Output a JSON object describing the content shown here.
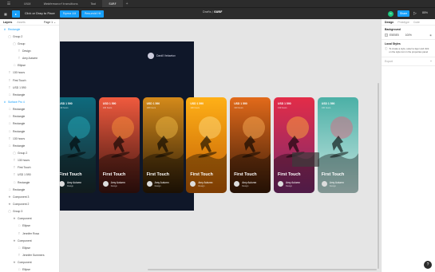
{
  "titlebar": {
    "tabs": [
      "UIUX",
      "Webfemoncrf transitions",
      "Tool",
      "SURF"
    ],
    "active_tab": 3
  },
  "toolbar": {
    "move_tool": "▸",
    "tooltip": "Click or Drag to Place",
    "button_a": "Figma Alt",
    "button_b": "Resumid Ht",
    "center_prefix": "Drafts /",
    "center_file": "SURF",
    "avatar_initial": "G",
    "share_label": "Share",
    "zoom_label": "85%"
  },
  "layers_panel": {
    "tab_layers": "Layers",
    "tab_assets": "Assets",
    "page_label": "Page 1 ⌄",
    "items": [
      {
        "label": "Rectangle",
        "indent": 0,
        "kind": "frame"
      },
      {
        "label": "Group 2",
        "indent": 1,
        "kind": "group"
      },
      {
        "label": "Group",
        "indent": 2,
        "kind": "group"
      },
      {
        "label": "Design",
        "indent": 3,
        "kind": "text"
      },
      {
        "label": "Amy Autumn",
        "indent": 3,
        "kind": "text"
      },
      {
        "label": "Ellipse",
        "indent": 2,
        "kind": "shape"
      },
      {
        "label": "130 hours",
        "indent": 1,
        "kind": "text"
      },
      {
        "label": "First Touch",
        "indent": 1,
        "kind": "text"
      },
      {
        "label": "USD 1 590",
        "indent": 1,
        "kind": "text"
      },
      {
        "label": "Rectangle",
        "indent": 1,
        "kind": "shape"
      },
      {
        "label": "Surface Pro 4",
        "indent": 0,
        "kind": "frame"
      },
      {
        "label": "Rectangle",
        "indent": 1,
        "kind": "shape"
      },
      {
        "label": "Rectangle",
        "indent": 1,
        "kind": "shape"
      },
      {
        "label": "Rectangle",
        "indent": 1,
        "kind": "shape"
      },
      {
        "label": "Rectangle",
        "indent": 1,
        "kind": "shape"
      },
      {
        "label": "130 hours",
        "indent": 1,
        "kind": "text"
      },
      {
        "label": "Rectangle",
        "indent": 1,
        "kind": "shape"
      },
      {
        "label": "Group 2",
        "indent": 2,
        "kind": "group"
      },
      {
        "label": "130 hours",
        "indent": 2,
        "kind": "text"
      },
      {
        "label": "First Touch",
        "indent": 2,
        "kind": "text"
      },
      {
        "label": "USD 1 590",
        "indent": 2,
        "kind": "text"
      },
      {
        "label": "Rectangle",
        "indent": 2,
        "kind": "shape"
      },
      {
        "label": "Rectangle",
        "indent": 1,
        "kind": "shape"
      },
      {
        "label": "Component 3",
        "indent": 1,
        "kind": "component"
      },
      {
        "label": "Component 2",
        "indent": 1,
        "kind": "component"
      },
      {
        "label": "Group 3",
        "indent": 1,
        "kind": "group"
      },
      {
        "label": "Component",
        "indent": 2,
        "kind": "component"
      },
      {
        "label": "Ellipse",
        "indent": 3,
        "kind": "shape"
      },
      {
        "label": "Jennifer Rosa",
        "indent": 3,
        "kind": "text"
      },
      {
        "label": "Component",
        "indent": 2,
        "kind": "component"
      },
      {
        "label": "Ellipse",
        "indent": 3,
        "kind": "shape"
      },
      {
        "label": "Jennifer Summers",
        "indent": 3,
        "kind": "text"
      },
      {
        "label": "Component",
        "indent": 2,
        "kind": "component"
      },
      {
        "label": "Ellipse",
        "indent": 3,
        "kind": "shape"
      }
    ]
  },
  "canvas": {
    "user_name": "Danill Veksetov",
    "cards": [
      {
        "price": "USD 1 590",
        "sub": "130 hours",
        "title": "First Touch",
        "author": "Amy Autumn",
        "role": "Design",
        "bg_top": "#0e6a7d",
        "bg_bottom": "#1b2a2e",
        "accent": "#29b3c4"
      },
      {
        "price": "USD 1 590",
        "sub": "130 hours",
        "title": "First Touch",
        "author": "Amy Autumn",
        "role": "Design",
        "bg_top": "#f05a3e",
        "bg_bottom": "#3c1410",
        "accent": "#ff9a3c"
      },
      {
        "price": "USD 1 590",
        "sub": "130 hours",
        "title": "First Touch",
        "author": "Amy Autumn",
        "role": "Design",
        "bg_top": "#d48a1a",
        "bg_bottom": "#2a1a06",
        "accent": "#f6c04a"
      },
      {
        "price": "USD 1 590",
        "sub": "130 hours",
        "title": "First Touch",
        "author": "Amy Autumn",
        "role": "Design",
        "bg_top": "#ffb017",
        "bg_bottom": "#c25e04",
        "accent": "#ffe08a"
      },
      {
        "price": "USD 1 590",
        "sub": "130 hours",
        "title": "First Touch",
        "author": "Amy Autumn",
        "role": "Design",
        "bg_top": "#e26a1a",
        "bg_bottom": "#3a1b08",
        "accent": "#ffb35a"
      },
      {
        "price": "USD 1 590",
        "sub": "130 hours",
        "title": "First Touch",
        "author": "Amy Autumn",
        "role": "Design",
        "bg_top": "#e32c48",
        "bg_bottom": "#7a2a6e",
        "accent": "#ffb83a"
      },
      {
        "price": "USD 1 590",
        "sub": "130 hours",
        "title": "First Touch",
        "author": "Amy Autumn",
        "role": "Design",
        "bg_top": "#4bb0a6",
        "bg_bottom": "#c8e6e2",
        "accent": "#e4607a"
      }
    ]
  },
  "design_panel": {
    "tab_design": "Design",
    "tab_prototype": "Prototype",
    "tab_code": "Code",
    "background_label": "Background",
    "bg_hex": "E5E5E5",
    "bg_opacity": "100%",
    "local_styles_label": "Local Styles",
    "info_text": "To create a style, select a layer and click on the style icon in the properties panel",
    "export_label": "Export",
    "export_plus": "+"
  },
  "help_label": "?"
}
